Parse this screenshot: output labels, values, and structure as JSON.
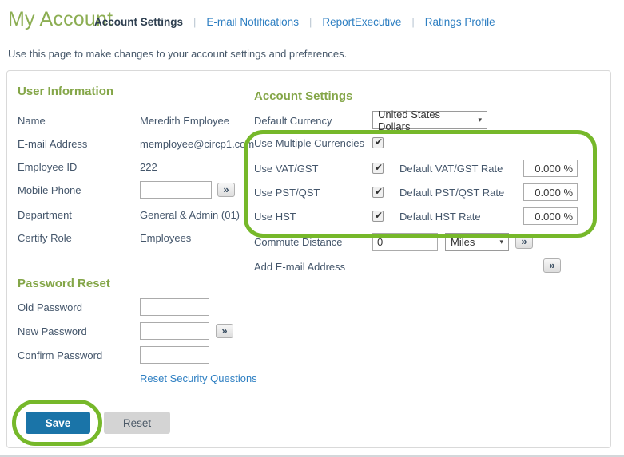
{
  "page": {
    "title": "My Account",
    "description": "Use this page to make changes to your account settings and preferences."
  },
  "tabs": [
    {
      "label": "Account Settings",
      "active": true
    },
    {
      "label": "E-mail Notifications",
      "active": false
    },
    {
      "label": "ReportExecutive",
      "active": false
    },
    {
      "label": "Ratings Profile",
      "active": false
    }
  ],
  "user_information": {
    "heading": "User Information",
    "name_label": "Name",
    "name_value": "Meredith Employee",
    "email_label": "E-mail Address",
    "email_value": "memployee@circp1.com",
    "employee_id_label": "Employee ID",
    "employee_id_value": "222",
    "mobile_phone_label": "Mobile Phone",
    "mobile_phone_value": "",
    "department_label": "Department",
    "department_value": "General & Admin (01)",
    "certify_role_label": "Certify Role",
    "certify_role_value": "Employees"
  },
  "password_reset": {
    "heading": "Password Reset",
    "old_password_label": "Old Password",
    "old_password_value": "",
    "new_password_label": "New Password",
    "new_password_value": "",
    "confirm_password_label": "Confirm Password",
    "confirm_password_value": "",
    "reset_security_link": "Reset Security Questions"
  },
  "account_settings": {
    "heading": "Account Settings",
    "default_currency_label": "Default Currency",
    "default_currency_value": "United States Dollars",
    "use_multiple_currencies_label": "Use Multiple Currencies",
    "use_multiple_currencies_checked": true,
    "rows": [
      {
        "use_label": "Use VAT/GST",
        "checked": true,
        "rate_label": "Default VAT/GST Rate",
        "rate_value": "0.000 %"
      },
      {
        "use_label": "Use PST/QST",
        "checked": true,
        "rate_label": "Default PST/QST Rate",
        "rate_value": "0.000 %"
      },
      {
        "use_label": "Use HST",
        "checked": true,
        "rate_label": "Default HST Rate",
        "rate_value": "0.000 %"
      }
    ],
    "commute_distance_label": "Commute Distance",
    "commute_distance_value": "0",
    "commute_unit_value": "Miles",
    "add_email_label": "Add E-mail Address",
    "add_email_value": ""
  },
  "actions": {
    "save_label": "Save",
    "reset_label": "Reset"
  },
  "icons": {
    "checkmark_glyph": "✔",
    "advance_glyph": "»",
    "dropdown_glyph": "▾",
    "separator_glyph": "|"
  },
  "colors": {
    "highlight_green": "#76b82a",
    "heading_green": "#84a648",
    "title_green": "#8cae53",
    "link_blue": "#2e7fc2",
    "save_blue": "#1a74a8",
    "text_dark": "#44566b"
  }
}
